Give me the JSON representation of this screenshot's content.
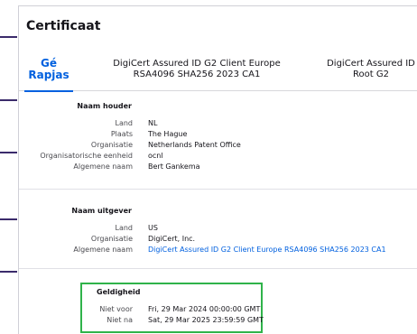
{
  "title": "Certificaat",
  "tabs": [
    {
      "label": "Gé Rapjas"
    },
    {
      "label": "DigiCert Assured ID G2 Client Europe RSA4096 SHA256 2023 CA1"
    },
    {
      "label": "DigiCert Assured ID Root G2"
    }
  ],
  "holder": {
    "heading": "Naam houder",
    "rows": [
      {
        "label": "Land",
        "value": "NL"
      },
      {
        "label": "Plaats",
        "value": "The Hague"
      },
      {
        "label": "Organisatie",
        "value": "Netherlands Patent Office"
      },
      {
        "label": "Organisatorische eenheid",
        "value": "ocnl"
      },
      {
        "label": "Algemene naam",
        "value": "Bert Gankema"
      }
    ]
  },
  "issuer": {
    "heading": "Naam uitgever",
    "rows": [
      {
        "label": "Land",
        "value": "US"
      },
      {
        "label": "Organisatie",
        "value": "DigiCert, Inc."
      },
      {
        "label": "Algemene naam",
        "value": "DigiCert Assured ID G2 Client Europe RSA4096 SHA256 2023 CA1"
      }
    ]
  },
  "validity": {
    "heading": "Geldigheid",
    "rows": [
      {
        "label": "Niet voor",
        "value": "Fri, 29 Mar 2024 00:00:00 GMT"
      },
      {
        "label": "Niet na",
        "value": "Sat, 29 Mar 2025 23:59:59 GMT"
      }
    ]
  },
  "colors": {
    "accent": "#0060df",
    "highlight_box": "#2fb34a",
    "side_marks": "#3b2b6b"
  }
}
